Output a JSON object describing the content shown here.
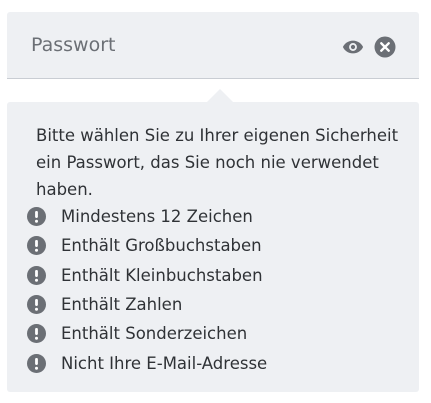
{
  "password_field": {
    "placeholder": "Passwort",
    "value": "",
    "show_icon": "eye-icon",
    "clear_icon": "clear-x-circle-icon"
  },
  "requirements_popover": {
    "intro": "Bitte wählen Sie zu Ihrer eigenen Sicherheit ein Passwort, das Sie noch nie verwendet haben.",
    "rules": [
      {
        "label": "Mindestens 12 Zeichen",
        "status": "unmet",
        "icon": "exclamation-circle-icon"
      },
      {
        "label": "Enthält Großbuchstaben",
        "status": "unmet",
        "icon": "exclamation-circle-icon"
      },
      {
        "label": "Enthält Kleinbuchstaben",
        "status": "unmet",
        "icon": "exclamation-circle-icon"
      },
      {
        "label": "Enthält Zahlen",
        "status": "unmet",
        "icon": "exclamation-circle-icon"
      },
      {
        "label": "Enthält Sonderzeichen",
        "status": "unmet",
        "icon": "exclamation-circle-icon"
      },
      {
        "label": "Nicht Ihre E-Mail-Adresse",
        "status": "unmet",
        "icon": "exclamation-circle-icon"
      }
    ]
  },
  "colors": {
    "background": "#eef0f3",
    "icon": "#6b6f75",
    "text": "#2f3236",
    "border": "#c9cdd3"
  }
}
